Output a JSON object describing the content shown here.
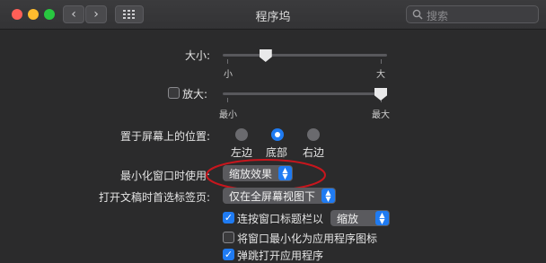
{
  "window": {
    "title": "程序坞"
  },
  "search": {
    "placeholder": "搜索"
  },
  "size": {
    "label": "大小:",
    "min_label": "小",
    "max_label": "大",
    "value": 0.25
  },
  "magnification": {
    "label": "放大:",
    "checked": false,
    "min_label": "最小",
    "max_label": "最大",
    "value": 1.0
  },
  "position": {
    "label": "置于屏幕上的位置:",
    "options": [
      {
        "label": "左边",
        "selected": false
      },
      {
        "label": "底部",
        "selected": true
      },
      {
        "label": "右边",
        "selected": false
      }
    ]
  },
  "minimize_effect": {
    "label": "最小化窗口时使用:",
    "value": "缩放效果"
  },
  "prefer_tabs": {
    "label": "打开文稿时首选标签页:",
    "value": "仅在全屏幕视图下"
  },
  "checkboxes": {
    "double_click": {
      "label": "连按窗口标题栏以",
      "checked": true,
      "action": "缩放"
    },
    "minimize_to_icon": {
      "label": "将窗口最小化为应用程序图标",
      "checked": false
    },
    "animate": {
      "label": "弹跳打开应用程序",
      "checked": true
    }
  },
  "colors": {
    "accent": "#1f7bf2",
    "annotation": "#c8161d",
    "background": "#2b2b2c"
  }
}
